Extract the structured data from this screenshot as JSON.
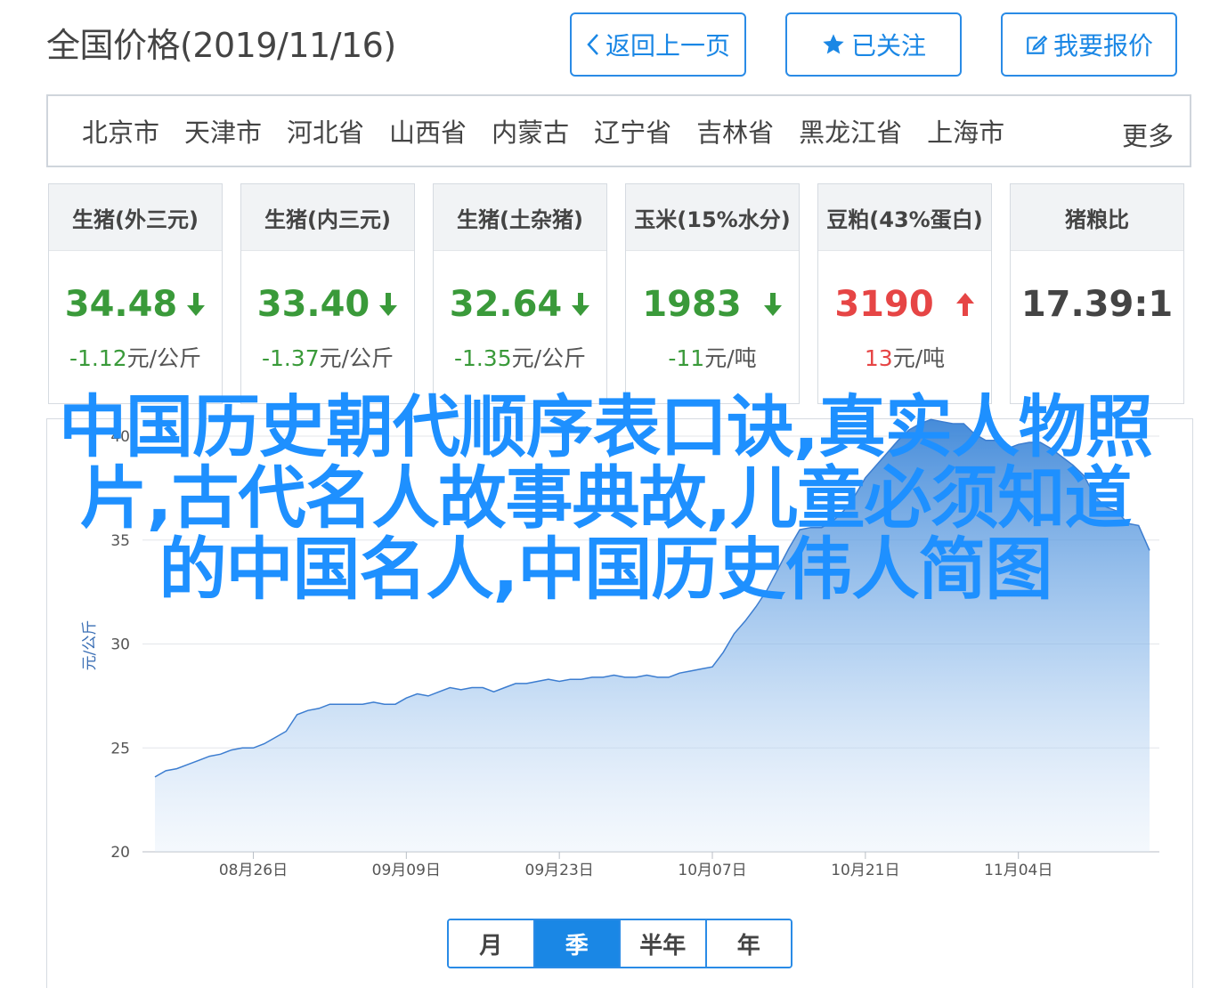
{
  "header": {
    "title": "全国价格(2019/11/16)",
    "back_label": "返回上一页",
    "follow_label": "已关注",
    "report_label": "我要报价"
  },
  "regions": {
    "items": [
      "北京市",
      "天津市",
      "河北省",
      "山西省",
      "内蒙古",
      "辽宁省",
      "吉林省",
      "黑龙江省",
      "上海市"
    ],
    "more_label": "更多"
  },
  "cards": [
    {
      "title": "生猪(外三元)",
      "price": "34.48",
      "trend": "down",
      "change_value": "-1.12",
      "change_unit": "元/公斤"
    },
    {
      "title": "生猪(内三元)",
      "price": "33.40",
      "trend": "down",
      "change_value": "-1.37",
      "change_unit": "元/公斤"
    },
    {
      "title": "生猪(土杂猪)",
      "price": "32.64",
      "trend": "down",
      "change_value": "-1.35",
      "change_unit": "元/公斤"
    },
    {
      "title": "玉米(15%水分)",
      "price": "1983",
      "trend": "down",
      "change_value": "-11",
      "change_unit": "元/吨"
    },
    {
      "title": "豆粕(43%蛋白)",
      "price": "3190",
      "trend": "up",
      "change_value": "13",
      "change_unit": "元/吨"
    },
    {
      "title": "猪粮比",
      "price": "17.39:1",
      "trend": "none",
      "change_value": "",
      "change_unit": ""
    }
  ],
  "overlay": {
    "line1": "中国历史朝代顺序表口诀,真实人物照",
    "line2": "片,古代名人故事典故,儿童必须知道",
    "line3": "的中国名人,中国历史伟人简图"
  },
  "chart_data": {
    "type": "area",
    "ylabel": "元/公斤",
    "ylim": [
      20,
      40
    ],
    "yticks": [
      20,
      25,
      30,
      35,
      40
    ],
    "xticks": [
      "08月26日",
      "09月09日",
      "09月23日",
      "10月07日",
      "10月21日",
      "11月04日"
    ],
    "x": [
      "2019-08-17",
      "2019-08-18",
      "2019-08-19",
      "2019-08-20",
      "2019-08-21",
      "2019-08-22",
      "2019-08-23",
      "2019-08-24",
      "2019-08-25",
      "2019-08-26",
      "2019-08-27",
      "2019-08-28",
      "2019-08-29",
      "2019-08-30",
      "2019-08-31",
      "2019-09-01",
      "2019-09-02",
      "2019-09-03",
      "2019-09-04",
      "2019-09-05",
      "2019-09-06",
      "2019-09-07",
      "2019-09-08",
      "2019-09-09",
      "2019-09-10",
      "2019-09-11",
      "2019-09-12",
      "2019-09-13",
      "2019-09-14",
      "2019-09-15",
      "2019-09-16",
      "2019-09-17",
      "2019-09-18",
      "2019-09-19",
      "2019-09-20",
      "2019-09-21",
      "2019-09-22",
      "2019-09-23",
      "2019-09-24",
      "2019-09-25",
      "2019-09-26",
      "2019-09-27",
      "2019-09-28",
      "2019-09-29",
      "2019-09-30",
      "2019-10-01",
      "2019-10-02",
      "2019-10-03",
      "2019-10-04",
      "2019-10-05",
      "2019-10-06",
      "2019-10-07",
      "2019-10-08",
      "2019-10-09",
      "2019-10-10",
      "2019-10-11",
      "2019-10-12",
      "2019-10-13",
      "2019-10-14",
      "2019-10-15",
      "2019-10-16",
      "2019-10-17",
      "2019-10-18",
      "2019-10-19",
      "2019-10-20",
      "2019-10-21",
      "2019-10-22",
      "2019-10-23",
      "2019-10-24",
      "2019-10-25",
      "2019-10-26",
      "2019-10-27",
      "2019-10-28",
      "2019-10-29",
      "2019-10-30",
      "2019-10-31",
      "2019-11-01",
      "2019-11-02",
      "2019-11-03",
      "2019-11-04",
      "2019-11-05",
      "2019-11-06",
      "2019-11-07",
      "2019-11-08",
      "2019-11-09",
      "2019-11-10",
      "2019-11-11",
      "2019-11-12",
      "2019-11-13",
      "2019-11-14",
      "2019-11-15",
      "2019-11-16"
    ],
    "series": [
      {
        "values": [
          23.6,
          23.9,
          24.0,
          24.2,
          24.4,
          24.6,
          24.7,
          24.9,
          25.0,
          25.0,
          25.2,
          25.5,
          25.8,
          26.6,
          26.8,
          26.9,
          27.1,
          27.1,
          27.1,
          27.1,
          27.2,
          27.1,
          27.1,
          27.4,
          27.6,
          27.5,
          27.7,
          27.9,
          27.8,
          27.9,
          27.9,
          27.7,
          27.9,
          28.1,
          28.1,
          28.2,
          28.3,
          28.2,
          28.3,
          28.3,
          28.4,
          28.4,
          28.5,
          28.4,
          28.4,
          28.5,
          28.4,
          28.4,
          28.6,
          28.7,
          28.8,
          28.9,
          29.6,
          30.5,
          31.1,
          31.8,
          32.6,
          33.6,
          34.6,
          35.5,
          35.6,
          35.6,
          35.9,
          36.4,
          37.1,
          38.0,
          38.6,
          39.2,
          39.8,
          40.3,
          40.6,
          40.8,
          40.7,
          40.6,
          40.6,
          40.1,
          39.8,
          39.8,
          39.4,
          39.6,
          39.7,
          39.7,
          39.4,
          39.0,
          38.6,
          38.1,
          37.1,
          36.6,
          36.4,
          35.8,
          35.7,
          34.5
        ]
      }
    ],
    "grid": true
  },
  "periods": {
    "items": [
      "月",
      "季",
      "半年",
      "年"
    ],
    "active": "季"
  }
}
